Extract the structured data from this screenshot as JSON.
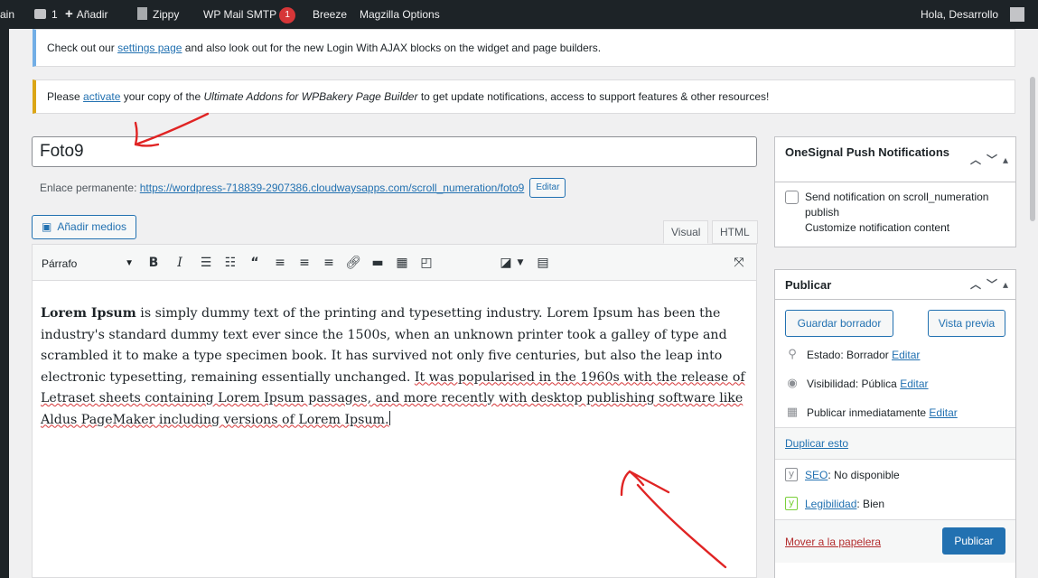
{
  "adminbar": {
    "site_fragment": "ain",
    "comments_count": "1",
    "add_new": "Añadir",
    "zippy": "Zippy",
    "wp_mail_smtp": "WP Mail SMTP",
    "wp_mail_smtp_badge": "1",
    "breeze": "Breeze",
    "magzilla": "Magzilla Options",
    "greeting": "Hola, Desarrollo"
  },
  "notices": {
    "info": {
      "prefix": "Check out our ",
      "link": "settings page",
      "suffix": " and also look out for the new Login With AJAX blocks on the widget and page builders."
    },
    "warn": {
      "prefix": "Please ",
      "link": "activate",
      "middle": " your copy of the ",
      "plugin": "Ultimate Addons for WPBakery Page Builder",
      "suffix": " to get update notifications, access to support features & other resources!"
    }
  },
  "post": {
    "title": "Foto9",
    "permalink_label": "Enlace permanente:",
    "permalink_url": "https://wordpress-718839-2907386.cloudwaysapps.com/scroll_numeration/foto9",
    "permalink_edit": "Editar"
  },
  "editor": {
    "add_media": "Añadir medios",
    "tab_visual": "Visual",
    "tab_html": "HTML",
    "format_select": "Párrafo",
    "content": {
      "bold_lead": "Lorem Ipsum",
      "part1": " is simply dummy text of the printing and typesetting industry. Lorem Ipsum has been the industry's standard dummy text ever since the 1500s, when an unknown printer took a galley of type and scrambled it to make a type specimen book. It has survived not only five centuries, but also the leap into electronic typesetting, remaining essentially unchanged. ",
      "part2": "It was popularised in the 1960s with the release of Letraset sheets containing Lorem Ipsum passages, and more recently with desktop publishing software like Aldus PageMaker including versions of Lorem Ipsum."
    }
  },
  "onesignal": {
    "title": "OneSignal Push Notifications",
    "send_label": "Send notification on scroll_numeration publish",
    "customize_label": "Customize notification content"
  },
  "publish": {
    "title": "Publicar",
    "save_draft": "Guardar borrador",
    "preview": "Vista previa",
    "status_label": "Estado:",
    "status_value": "Borrador",
    "visibility_label": "Visibilidad:",
    "visibility_value": "Pública",
    "publish_time": "Publicar inmediatamente",
    "edit": "Editar",
    "duplicate": "Duplicar esto",
    "seo_label": "SEO",
    "seo_value": ": No disponible",
    "readability_label": "Legibilidad",
    "readability_value": ": Bien",
    "trash": "Mover a la papelera",
    "publish_button": "Publicar"
  },
  "colors": {
    "primary": "#2271b1",
    "admin_bar": "#1d2327",
    "notice_info": "#72aee6",
    "notice_warn": "#dba617",
    "annotation_arrow": "#e02424"
  }
}
